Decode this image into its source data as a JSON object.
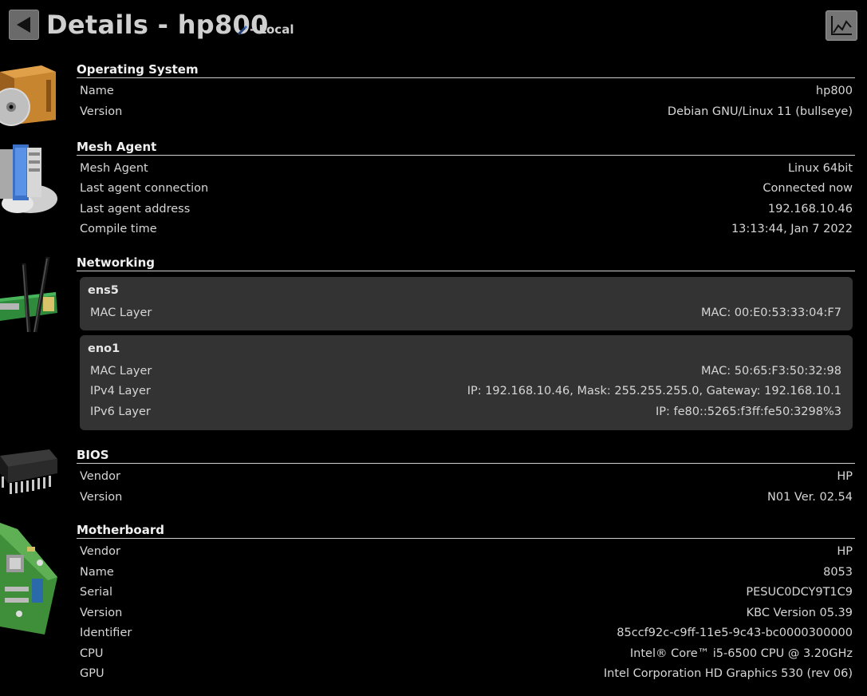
{
  "header": {
    "title": "Details - hp800",
    "subtitle": "- Local"
  },
  "sections": {
    "os": {
      "title": "Operating System",
      "rows": [
        {
          "k": "Name",
          "v": "hp800"
        },
        {
          "k": "Version",
          "v": "Debian GNU/Linux 11 (bullseye)"
        }
      ]
    },
    "agent": {
      "title": "Mesh Agent",
      "rows": [
        {
          "k": "Mesh Agent",
          "v": "Linux 64bit"
        },
        {
          "k": "Last agent connection",
          "v": "Connected now"
        },
        {
          "k": "Last agent address",
          "v": "192.168.10.46"
        },
        {
          "k": "Compile time",
          "v": "13:13:44, Jan 7 2022"
        }
      ]
    },
    "net": {
      "title": "Networking",
      "interfaces": [
        {
          "name": "ens5",
          "rows": [
            {
              "k": "MAC Layer",
              "v": "MAC: 00:E0:53:33:04:F7"
            }
          ]
        },
        {
          "name": "eno1",
          "rows": [
            {
              "k": "MAC Layer",
              "v": "MAC: 50:65:F3:50:32:98"
            },
            {
              "k": "IPv4 Layer",
              "v": "IP: 192.168.10.46, Mask: 255.255.255.0, Gateway: 192.168.10.1"
            },
            {
              "k": "IPv6 Layer",
              "v": "IP: fe80::5265:f3ff:fe50:3298%3"
            }
          ]
        }
      ]
    },
    "bios": {
      "title": "BIOS",
      "rows": [
        {
          "k": "Vendor",
          "v": "HP"
        },
        {
          "k": "Version",
          "v": "N01 Ver. 02.54"
        }
      ]
    },
    "mb": {
      "title": "Motherboard",
      "rows": [
        {
          "k": "Vendor",
          "v": "HP"
        },
        {
          "k": "Name",
          "v": "8053"
        },
        {
          "k": "Serial",
          "v": "PESUC0DCY9T1C9"
        },
        {
          "k": "Version",
          "v": "KBC Version 05.39"
        },
        {
          "k": "Identifier",
          "v": "85ccf92c-c9ff-11e5-9c43-bc0000300000"
        },
        {
          "k": "CPU",
          "v": "Intel® Core™ i5-6500 CPU @ 3.20GHz"
        },
        {
          "k": "GPU",
          "v": "Intel Corporation HD Graphics 530 (rev 06)"
        }
      ]
    }
  },
  "icons": {
    "back": "back-arrow-icon",
    "edit": "pencil-icon",
    "chart": "chart-icon",
    "os": "software-box-icon",
    "agent": "server-icon",
    "net": "network-card-icon",
    "bios": "chip-icon",
    "mb": "motherboard-icon"
  }
}
